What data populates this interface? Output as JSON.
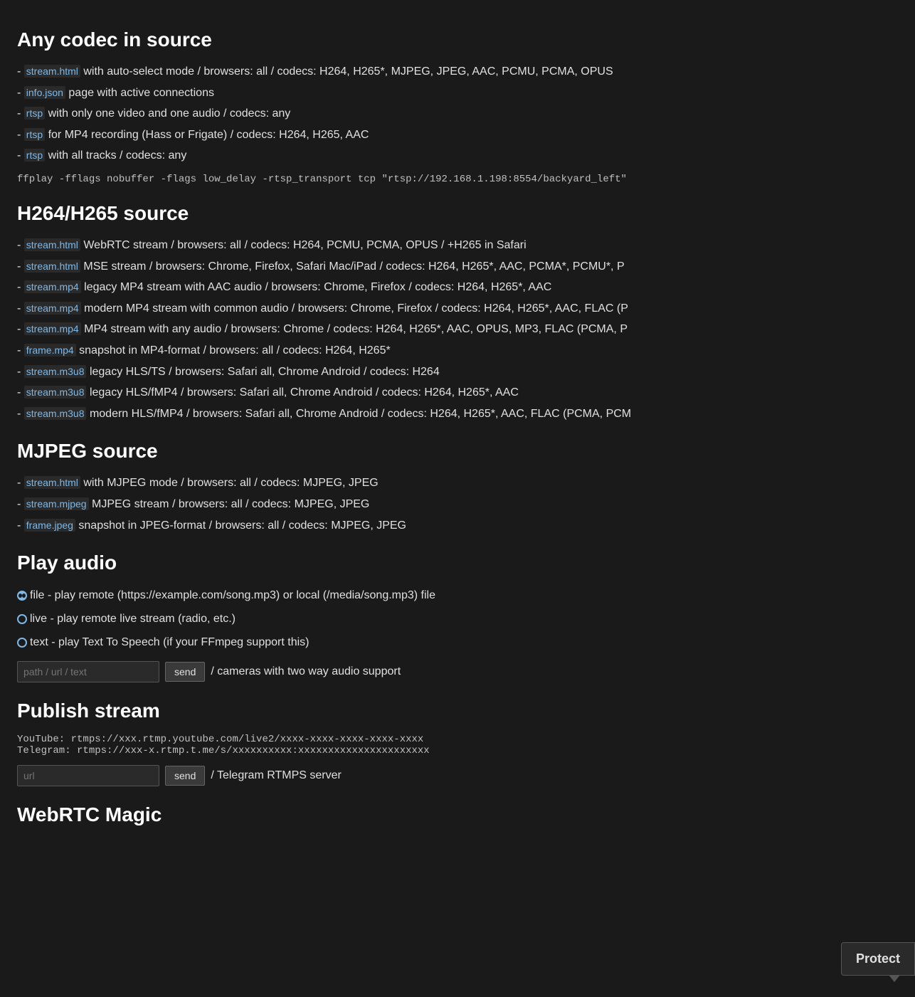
{
  "sections": {
    "any_codec": {
      "title": "Any codec in source",
      "items": [
        {
          "link": "stream.html",
          "text": "with auto-select mode / browsers: all / codecs: H264, H265*, MJPEG, JPEG, AAC, PCMU, PCMA, OPUS"
        },
        {
          "link": "info.json",
          "text": "page with active connections"
        },
        {
          "link": "rtsp",
          "text": "with only one video and one audio / codecs: any"
        },
        {
          "link": "rtsp",
          "text": "for MP4 recording (Hass or Frigate) / codecs: H264, H265, AAC"
        },
        {
          "link": "rtsp",
          "text": "with all tracks / codecs: any"
        }
      ],
      "code": "ffplay -fflags nobuffer -flags low_delay -rtsp_transport tcp \"rtsp://192.168.1.198:8554/backyard_left\""
    },
    "h264_h265": {
      "title": "H264/H265 source",
      "items": [
        {
          "link": "stream.html",
          "text": "WebRTC stream / browsers: all / codecs: H264, PCMU, PCMA, OPUS / +H265 in Safari"
        },
        {
          "link": "stream.html",
          "text": "MSE stream / browsers: Chrome, Firefox, Safari Mac/iPad / codecs: H264, H265*, AAC, PCMA*, PCMU*, P"
        },
        {
          "link": "stream.mp4",
          "text": "legacy MP4 stream with AAC audio / browsers: Chrome, Firefox / codecs: H264, H265*, AAC"
        },
        {
          "link": "stream.mp4",
          "text": "modern MP4 stream with common audio / browsers: Chrome, Firefox / codecs: H264, H265*, AAC, FLAC (P"
        },
        {
          "link": "stream.mp4",
          "text": "MP4 stream with any audio / browsers: Chrome / codecs: H264, H265*, AAC, OPUS, MP3, FLAC (PCMA, P"
        },
        {
          "link": "frame.mp4",
          "text": "snapshot in MP4-format / browsers: all / codecs: H264, H265*"
        },
        {
          "link": "stream.m3u8",
          "text": "legacy HLS/TS / browsers: Safari all, Chrome Android / codecs: H264"
        },
        {
          "link": "stream.m3u8",
          "text": "legacy HLS/fMP4 / browsers: Safari all, Chrome Android / codecs: H264, H265*, AAC"
        },
        {
          "link": "stream.m3u8",
          "text": "modern HLS/fMP4 / browsers: Safari all, Chrome Android / codecs: H264, H265*, AAC, FLAC (PCMA, PCM"
        }
      ]
    },
    "mjpeg": {
      "title": "MJPEG source",
      "items": [
        {
          "link": "stream.html",
          "text": "with MJPEG mode / browsers: all / codecs: MJPEG, JPEG"
        },
        {
          "link": "stream.mjpeg",
          "text": "MJPEG stream / browsers: all / codecs: MJPEG, JPEG"
        },
        {
          "link": "frame.jpeg",
          "text": "snapshot in JPEG-format / browsers: all / codecs: MJPEG, JPEG"
        }
      ]
    },
    "play_audio": {
      "title": "Play audio",
      "radio_options": [
        {
          "value": "file",
          "label": "file - play remote (https://example.com/song.mp3) or local (/media/song.mp3) file",
          "active": true
        },
        {
          "value": "live",
          "label": "live - play remote live stream (radio, etc.)",
          "active": false
        },
        {
          "value": "text",
          "label": "text - play Text To Speech (if your FFmpeg support this)",
          "active": false
        }
      ],
      "input_placeholder": "path / url / text",
      "send_label": "send",
      "input_suffix": "/ cameras with two way audio support"
    },
    "publish_stream": {
      "title": "Publish stream",
      "code_lines": [
        "YouTube:  rtmps://xxx.rtmp.youtube.com/live2/xxxx-xxxx-xxxx-xxxx-xxxx",
        "Telegram: rtmps://xxx-x.rtmp.t.me/s/xxxxxxxxxx:xxxxxxxxxxxxxxxxxxxxxx"
      ],
      "input_placeholder": "url",
      "send_label": "send",
      "input_suffix": "/ Telegram RTMPS server"
    },
    "protect_tooltip": {
      "label": "Protect"
    },
    "webrtc_magic": {
      "title": "WebRTC Magic"
    }
  }
}
